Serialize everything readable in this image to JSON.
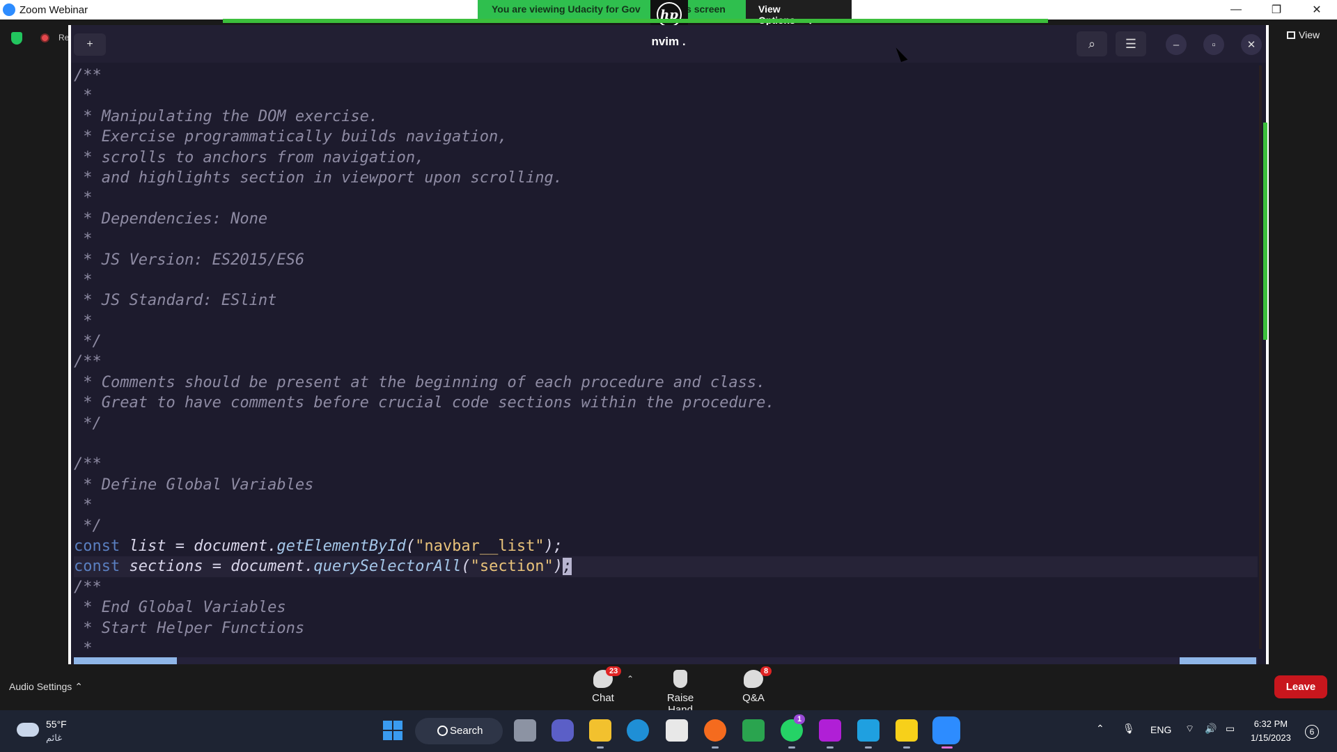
{
  "window": {
    "title": "Zoom Webinar",
    "controls": [
      "—",
      "❐",
      "✕"
    ]
  },
  "share_banner": {
    "message": "You are viewing Udacity for Gov",
    "message_suffix": "'s screen",
    "view_options": "View Options",
    "presenter_logo": "hp"
  },
  "meeting": {
    "recording_label": "Recording",
    "view_label": "View"
  },
  "terminal": {
    "tab_button": "+",
    "title": "nvim .",
    "icons": [
      "search-icon",
      "menu-icon",
      "minimize-icon",
      "restore-icon",
      "close-icon"
    ]
  },
  "code_lines": [
    {
      "text": "/**",
      "kind": "cm"
    },
    {
      "text": " *",
      "kind": "cm"
    },
    {
      "text": " * Manipulating the DOM exercise.",
      "kind": "cm"
    },
    {
      "text": " * Exercise programmatically builds navigation,",
      "kind": "cm"
    },
    {
      "text": " * scrolls to anchors from navigation,",
      "kind": "cm"
    },
    {
      "text": " * and highlights section in viewport upon scrolling.",
      "kind": "cm"
    },
    {
      "text": " *",
      "kind": "cm"
    },
    {
      "text": " * Dependencies: None",
      "kind": "cm"
    },
    {
      "text": " *",
      "kind": "cm"
    },
    {
      "text": " * JS Version: ES2015/ES6",
      "kind": "cm"
    },
    {
      "text": " *",
      "kind": "cm"
    },
    {
      "text": " * JS Standard: ESlint",
      "kind": "cm"
    },
    {
      "text": " *",
      "kind": "cm"
    },
    {
      "text": " */",
      "kind": "cm"
    },
    {
      "text": "/**",
      "kind": "cm"
    },
    {
      "text": " * Comments should be present at the beginning of each procedure and class.",
      "kind": "cm"
    },
    {
      "text": " * Great to have comments before crucial code sections within the procedure.",
      "kind": "cm"
    },
    {
      "text": " */",
      "kind": "cm"
    },
    {
      "text": "",
      "kind": "cm"
    },
    {
      "text": "/**",
      "kind": "cm"
    },
    {
      "text": " * Define Global Variables",
      "kind": "cm"
    },
    {
      "text": " *",
      "kind": "cm"
    },
    {
      "text": " */",
      "kind": "cm"
    },
    {
      "kind": "code",
      "kw": "const",
      "name": "list",
      "obj": "document",
      "method": "getElementById",
      "arg": "\"navbar__list\"",
      "end": ");",
      "highlight": false
    },
    {
      "kind": "code",
      "kw": "const",
      "name": "sections",
      "obj": "document",
      "method": "querySelectorAll",
      "arg": "\"section\"",
      "end": ")",
      "cursor": ";",
      "highlight": true
    },
    {
      "text": "/**",
      "kind": "cm"
    },
    {
      "text": " * End Global Variables",
      "kind": "cm"
    },
    {
      "text": " * Start Helper Functions",
      "kind": "cm"
    },
    {
      "text": " *",
      "kind": "cm"
    }
  ],
  "controls": {
    "audio_settings": "Audio Settings",
    "chat": {
      "label": "Chat",
      "badge": "23"
    },
    "raise_hand": {
      "label": "Raise Hand"
    },
    "qa": {
      "label": "Q&A",
      "badge": "8"
    },
    "leave": "Leave"
  },
  "taskbar": {
    "weather_temp": "55°F",
    "weather_condition": "غائم",
    "search_label": "Search",
    "language": "ENG",
    "time": "6:32 PM",
    "date": "1/15/2023",
    "notifications": "6",
    "whatsapp_badge": "1"
  },
  "colors": {
    "accent_green": "#2fbf4e",
    "leave_red": "#c8161d",
    "editor_bg": "#1d1b2d"
  }
}
